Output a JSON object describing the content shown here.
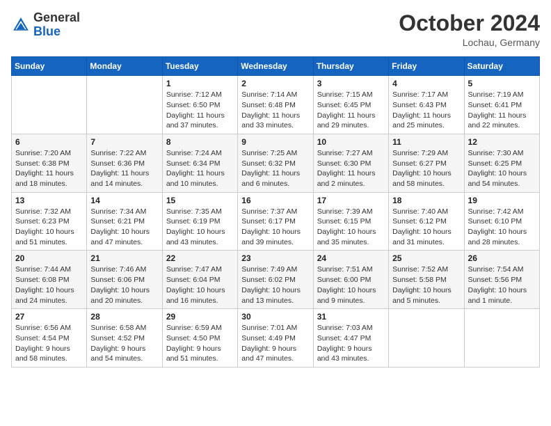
{
  "header": {
    "logo_general": "General",
    "logo_blue": "Blue",
    "month_title": "October 2024",
    "location": "Lochau, Germany"
  },
  "weekdays": [
    "Sunday",
    "Monday",
    "Tuesday",
    "Wednesday",
    "Thursday",
    "Friday",
    "Saturday"
  ],
  "weeks": [
    [
      {
        "day": "",
        "sunrise": "",
        "sunset": "",
        "daylight": ""
      },
      {
        "day": "",
        "sunrise": "",
        "sunset": "",
        "daylight": ""
      },
      {
        "day": "1",
        "sunrise": "Sunrise: 7:12 AM",
        "sunset": "Sunset: 6:50 PM",
        "daylight": "Daylight: 11 hours and 37 minutes."
      },
      {
        "day": "2",
        "sunrise": "Sunrise: 7:14 AM",
        "sunset": "Sunset: 6:48 PM",
        "daylight": "Daylight: 11 hours and 33 minutes."
      },
      {
        "day": "3",
        "sunrise": "Sunrise: 7:15 AM",
        "sunset": "Sunset: 6:45 PM",
        "daylight": "Daylight: 11 hours and 29 minutes."
      },
      {
        "day": "4",
        "sunrise": "Sunrise: 7:17 AM",
        "sunset": "Sunset: 6:43 PM",
        "daylight": "Daylight: 11 hours and 25 minutes."
      },
      {
        "day": "5",
        "sunrise": "Sunrise: 7:19 AM",
        "sunset": "Sunset: 6:41 PM",
        "daylight": "Daylight: 11 hours and 22 minutes."
      }
    ],
    [
      {
        "day": "6",
        "sunrise": "Sunrise: 7:20 AM",
        "sunset": "Sunset: 6:38 PM",
        "daylight": "Daylight: 11 hours and 18 minutes."
      },
      {
        "day": "7",
        "sunrise": "Sunrise: 7:22 AM",
        "sunset": "Sunset: 6:36 PM",
        "daylight": "Daylight: 11 hours and 14 minutes."
      },
      {
        "day": "8",
        "sunrise": "Sunrise: 7:24 AM",
        "sunset": "Sunset: 6:34 PM",
        "daylight": "Daylight: 11 hours and 10 minutes."
      },
      {
        "day": "9",
        "sunrise": "Sunrise: 7:25 AM",
        "sunset": "Sunset: 6:32 PM",
        "daylight": "Daylight: 11 hours and 6 minutes."
      },
      {
        "day": "10",
        "sunrise": "Sunrise: 7:27 AM",
        "sunset": "Sunset: 6:30 PM",
        "daylight": "Daylight: 11 hours and 2 minutes."
      },
      {
        "day": "11",
        "sunrise": "Sunrise: 7:29 AM",
        "sunset": "Sunset: 6:27 PM",
        "daylight": "Daylight: 10 hours and 58 minutes."
      },
      {
        "day": "12",
        "sunrise": "Sunrise: 7:30 AM",
        "sunset": "Sunset: 6:25 PM",
        "daylight": "Daylight: 10 hours and 54 minutes."
      }
    ],
    [
      {
        "day": "13",
        "sunrise": "Sunrise: 7:32 AM",
        "sunset": "Sunset: 6:23 PM",
        "daylight": "Daylight: 10 hours and 51 minutes."
      },
      {
        "day": "14",
        "sunrise": "Sunrise: 7:34 AM",
        "sunset": "Sunset: 6:21 PM",
        "daylight": "Daylight: 10 hours and 47 minutes."
      },
      {
        "day": "15",
        "sunrise": "Sunrise: 7:35 AM",
        "sunset": "Sunset: 6:19 PM",
        "daylight": "Daylight: 10 hours and 43 minutes."
      },
      {
        "day": "16",
        "sunrise": "Sunrise: 7:37 AM",
        "sunset": "Sunset: 6:17 PM",
        "daylight": "Daylight: 10 hours and 39 minutes."
      },
      {
        "day": "17",
        "sunrise": "Sunrise: 7:39 AM",
        "sunset": "Sunset: 6:15 PM",
        "daylight": "Daylight: 10 hours and 35 minutes."
      },
      {
        "day": "18",
        "sunrise": "Sunrise: 7:40 AM",
        "sunset": "Sunset: 6:12 PM",
        "daylight": "Daylight: 10 hours and 31 minutes."
      },
      {
        "day": "19",
        "sunrise": "Sunrise: 7:42 AM",
        "sunset": "Sunset: 6:10 PM",
        "daylight": "Daylight: 10 hours and 28 minutes."
      }
    ],
    [
      {
        "day": "20",
        "sunrise": "Sunrise: 7:44 AM",
        "sunset": "Sunset: 6:08 PM",
        "daylight": "Daylight: 10 hours and 24 minutes."
      },
      {
        "day": "21",
        "sunrise": "Sunrise: 7:46 AM",
        "sunset": "Sunset: 6:06 PM",
        "daylight": "Daylight: 10 hours and 20 minutes."
      },
      {
        "day": "22",
        "sunrise": "Sunrise: 7:47 AM",
        "sunset": "Sunset: 6:04 PM",
        "daylight": "Daylight: 10 hours and 16 minutes."
      },
      {
        "day": "23",
        "sunrise": "Sunrise: 7:49 AM",
        "sunset": "Sunset: 6:02 PM",
        "daylight": "Daylight: 10 hours and 13 minutes."
      },
      {
        "day": "24",
        "sunrise": "Sunrise: 7:51 AM",
        "sunset": "Sunset: 6:00 PM",
        "daylight": "Daylight: 10 hours and 9 minutes."
      },
      {
        "day": "25",
        "sunrise": "Sunrise: 7:52 AM",
        "sunset": "Sunset: 5:58 PM",
        "daylight": "Daylight: 10 hours and 5 minutes."
      },
      {
        "day": "26",
        "sunrise": "Sunrise: 7:54 AM",
        "sunset": "Sunset: 5:56 PM",
        "daylight": "Daylight: 10 hours and 1 minute."
      }
    ],
    [
      {
        "day": "27",
        "sunrise": "Sunrise: 6:56 AM",
        "sunset": "Sunset: 4:54 PM",
        "daylight": "Daylight: 9 hours and 58 minutes."
      },
      {
        "day": "28",
        "sunrise": "Sunrise: 6:58 AM",
        "sunset": "Sunset: 4:52 PM",
        "daylight": "Daylight: 9 hours and 54 minutes."
      },
      {
        "day": "29",
        "sunrise": "Sunrise: 6:59 AM",
        "sunset": "Sunset: 4:50 PM",
        "daylight": "Daylight: 9 hours and 51 minutes."
      },
      {
        "day": "30",
        "sunrise": "Sunrise: 7:01 AM",
        "sunset": "Sunset: 4:49 PM",
        "daylight": "Daylight: 9 hours and 47 minutes."
      },
      {
        "day": "31",
        "sunrise": "Sunrise: 7:03 AM",
        "sunset": "Sunset: 4:47 PM",
        "daylight": "Daylight: 9 hours and 43 minutes."
      },
      {
        "day": "",
        "sunrise": "",
        "sunset": "",
        "daylight": ""
      },
      {
        "day": "",
        "sunrise": "",
        "sunset": "",
        "daylight": ""
      }
    ]
  ]
}
